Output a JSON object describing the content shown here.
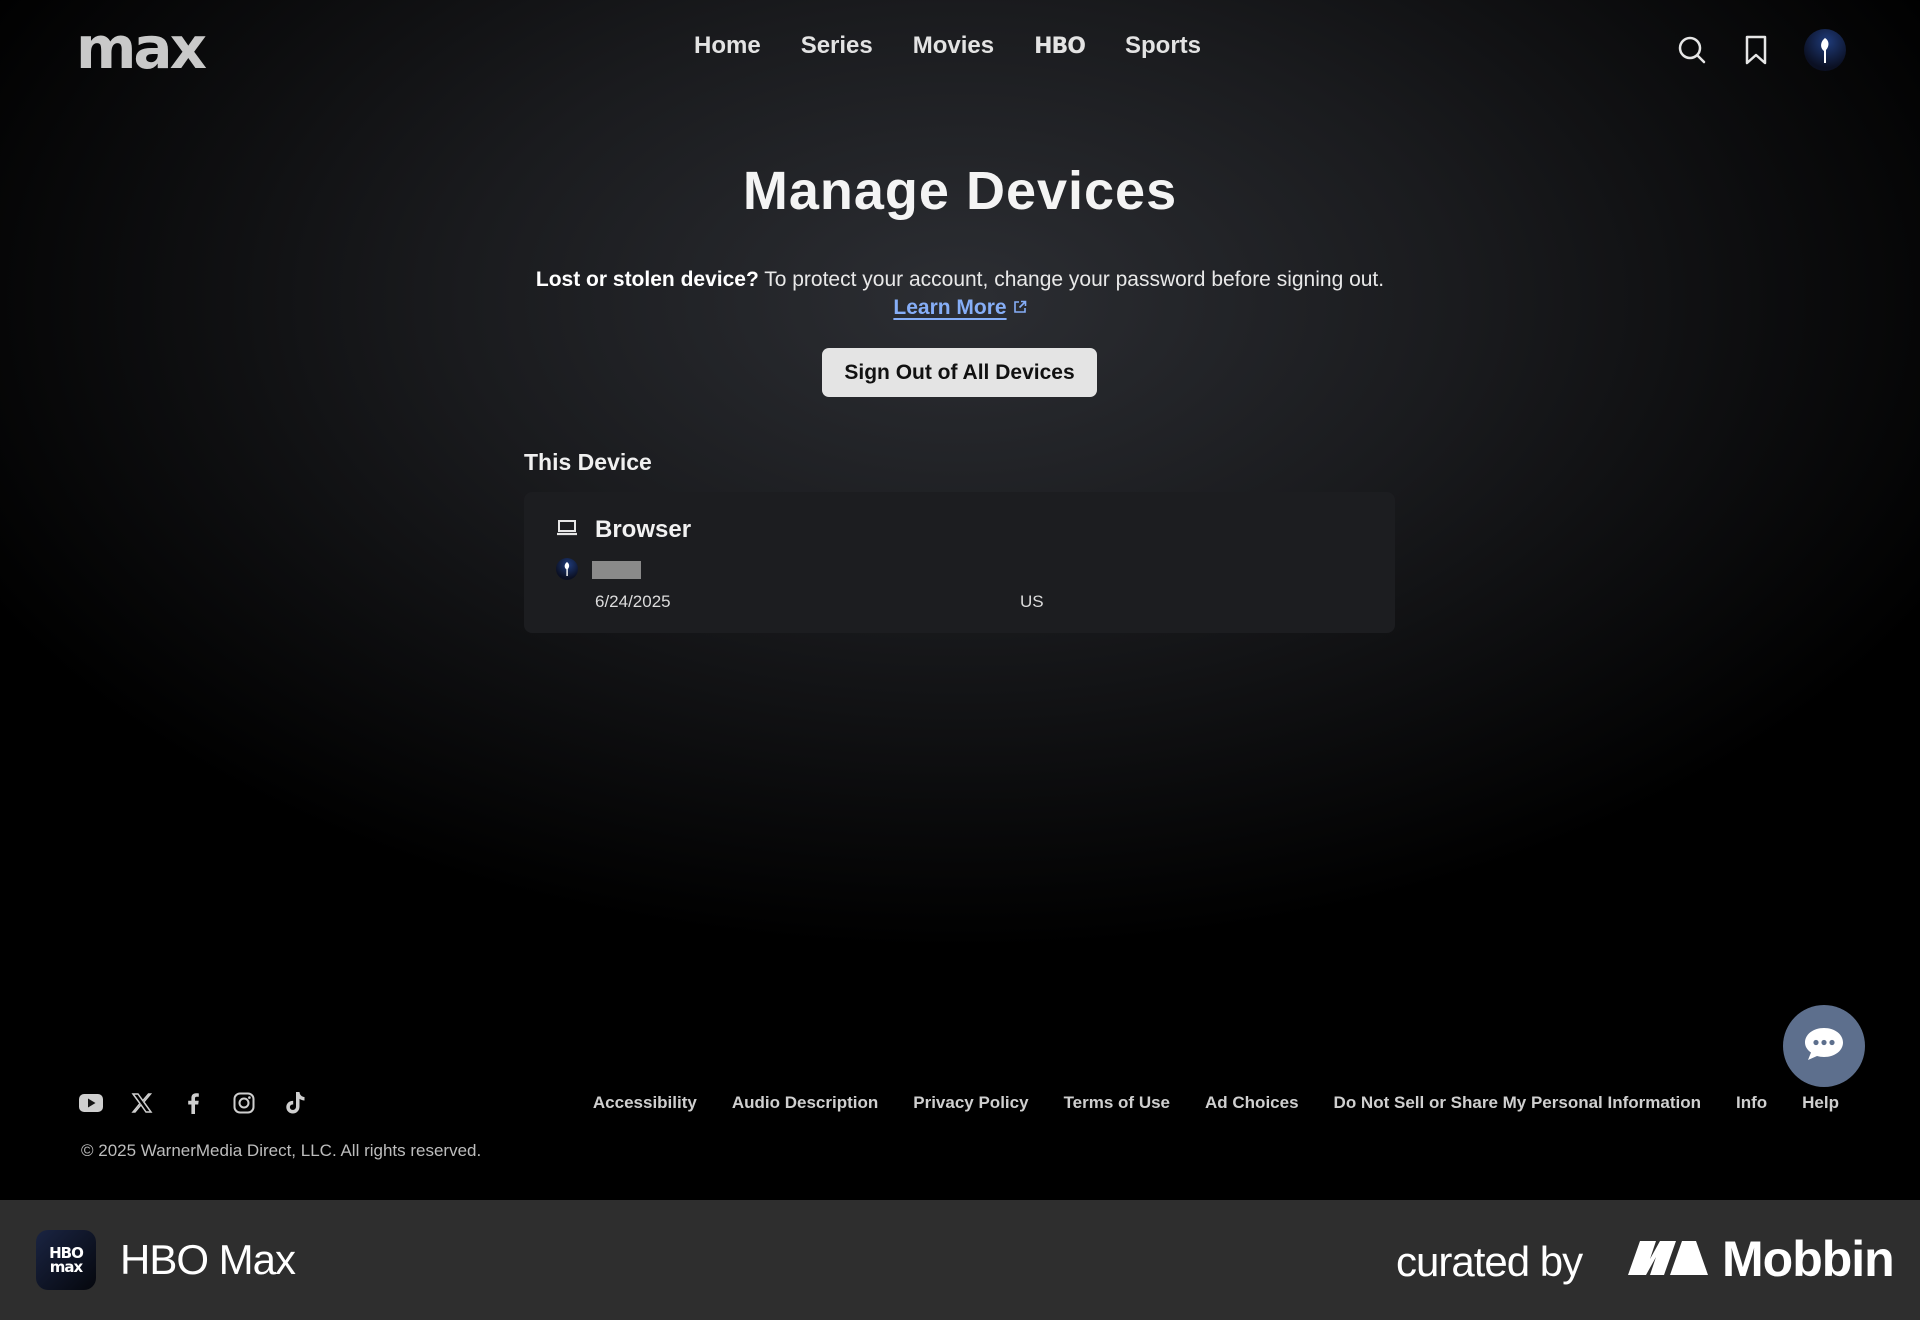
{
  "header": {
    "logo_text": "max",
    "nav": [
      "Home",
      "Series",
      "Movies",
      "HBO",
      "Sports"
    ],
    "icons": [
      "search-icon",
      "bookmark-icon",
      "avatar"
    ]
  },
  "main": {
    "title": "Manage Devices",
    "notice_bold": "Lost or stolen device?",
    "notice_text": " To protect your account, change your password before signing out.",
    "learn_more": "Learn More",
    "signout_button": "Sign Out of All Devices",
    "section_label": "This Device",
    "device": {
      "name": "Browser",
      "date": "6/24/2025",
      "country": "US"
    }
  },
  "footer": {
    "social": [
      "youtube-icon",
      "x-icon",
      "facebook-icon",
      "instagram-icon",
      "tiktok-icon"
    ],
    "links": [
      "Accessibility",
      "Audio Description",
      "Privacy Policy",
      "Terms of Use",
      "Ad Choices",
      "Do Not Sell or Share My Personal Information",
      "Info",
      "Help"
    ],
    "copyright": "© 2025 WarnerMedia Direct, LLC. All rights reserved."
  },
  "banner": {
    "app_icon_top": "HBO",
    "app_icon_bottom": "max",
    "app_name": "HBO Max",
    "curated_by": "curated by",
    "brand": "Mobbin"
  },
  "colors": {
    "link": "#86aef7",
    "button_bg": "#e4e4e4",
    "card_bg": "#1c1d20",
    "chat_bg": "#5d6f8d",
    "banner_bg": "#2e2e2e"
  }
}
